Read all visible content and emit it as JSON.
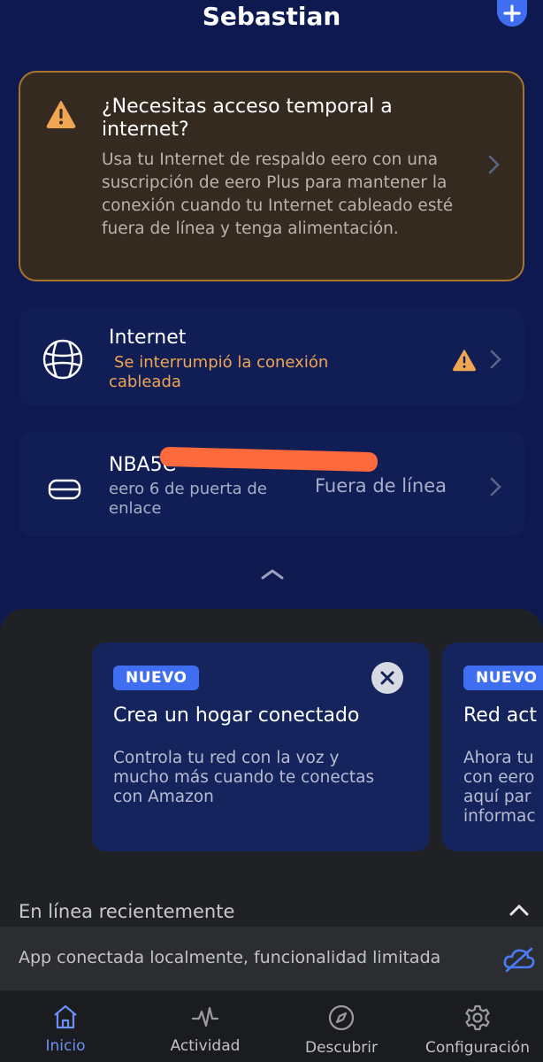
{
  "header": {
    "title": "Sebastian"
  },
  "alert": {
    "title": "¿Necesitas acceso temporal a internet?",
    "body": "Usa tu Internet de respaldo eero con una suscripción de eero Plus para mantener la conexión cuando tu Internet cableado esté fuera de línea y tenga alimentación."
  },
  "internet_card": {
    "title": "Internet",
    "status": "Se interrumpió la conexión cableada"
  },
  "device_card": {
    "name": "NBA5C",
    "model": "eero 6 de puerta de enlace",
    "status": "Fuera de línea"
  },
  "promos": [
    {
      "badge": "NUEVO",
      "title": "Crea un hogar conectado",
      "body": "Controla tu red con la voz y mucho más cuando te conectas con Amazon"
    },
    {
      "badge": "NUEVO",
      "title": "Red act",
      "body": "Ahora tu con eero aquí par informac"
    }
  ],
  "recent": {
    "label": "En línea recientemente"
  },
  "status_bar": {
    "text": "App conectada localmente, funcionalidad limitada"
  },
  "nav": {
    "items": [
      {
        "label": "Inicio"
      },
      {
        "label": "Actividad"
      },
      {
        "label": "Descubrir"
      },
      {
        "label": "Configuración"
      }
    ]
  },
  "colors": {
    "background": "#0e1a4f",
    "accent": "#3f6ff0",
    "warning": "#f0a552",
    "nav_active": "#6b8ff5"
  }
}
